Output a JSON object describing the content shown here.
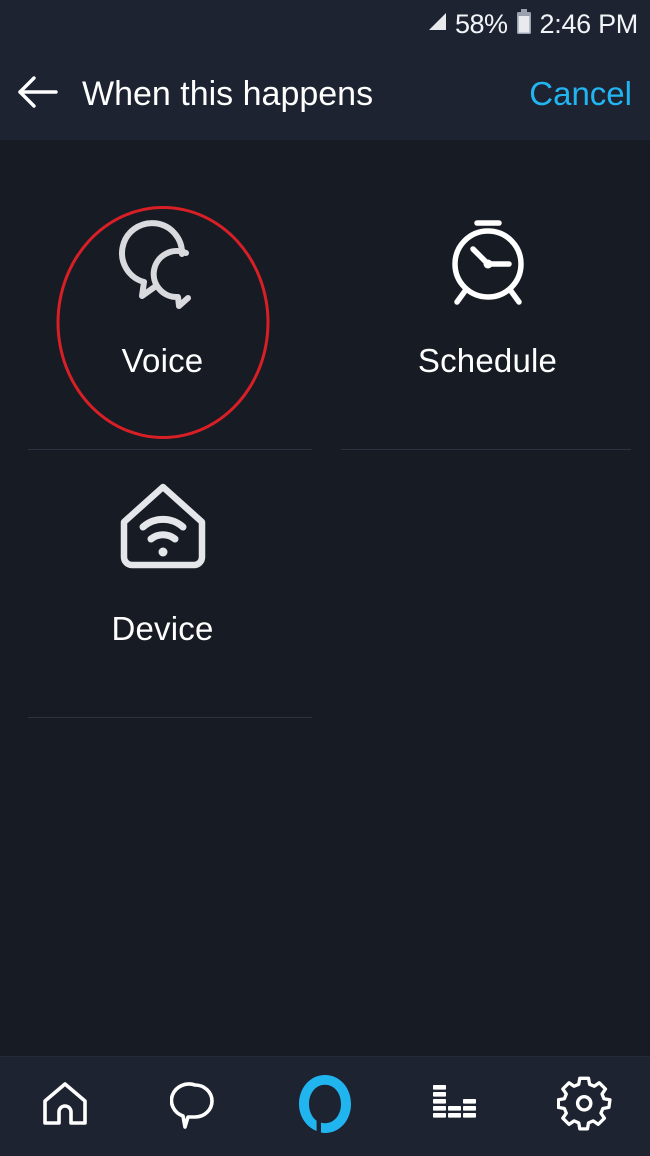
{
  "statusbar": {
    "signal_icon": "cellular-signal-icon",
    "battery_percent": "58%",
    "battery_icon": "battery-icon",
    "time": "2:46 PM"
  },
  "header": {
    "back_icon": "back-arrow-icon",
    "title": "When this happens",
    "cancel_label": "Cancel",
    "cancel_color": "#23b5f2"
  },
  "main": {
    "tiles": [
      {
        "id": "voice",
        "label": "Voice",
        "icon": "speech-bubbles-icon",
        "highlighted": true,
        "divider": true
      },
      {
        "id": "schedule",
        "label": "Schedule",
        "icon": "alarm-clock-icon",
        "highlighted": false,
        "divider": true
      },
      {
        "id": "device",
        "label": "Device",
        "icon": "home-wifi-icon",
        "highlighted": false,
        "divider": true
      }
    ],
    "highlight_color": "#d81f26"
  },
  "bottomnav": {
    "items": [
      {
        "id": "home",
        "icon": "home-icon",
        "active": false
      },
      {
        "id": "communicate",
        "icon": "speech-bubble-icon",
        "active": false
      },
      {
        "id": "alexa",
        "icon": "alexa-logo-icon",
        "active": true
      },
      {
        "id": "play",
        "icon": "equalizer-icon",
        "active": false
      },
      {
        "id": "settings",
        "icon": "gear-icon",
        "active": false
      }
    ],
    "active_color": "#21b5f0"
  },
  "colors": {
    "background": "#161b24",
    "bar_background": "#1d2330",
    "text": "#ffffff",
    "divider": "#2c3340"
  }
}
